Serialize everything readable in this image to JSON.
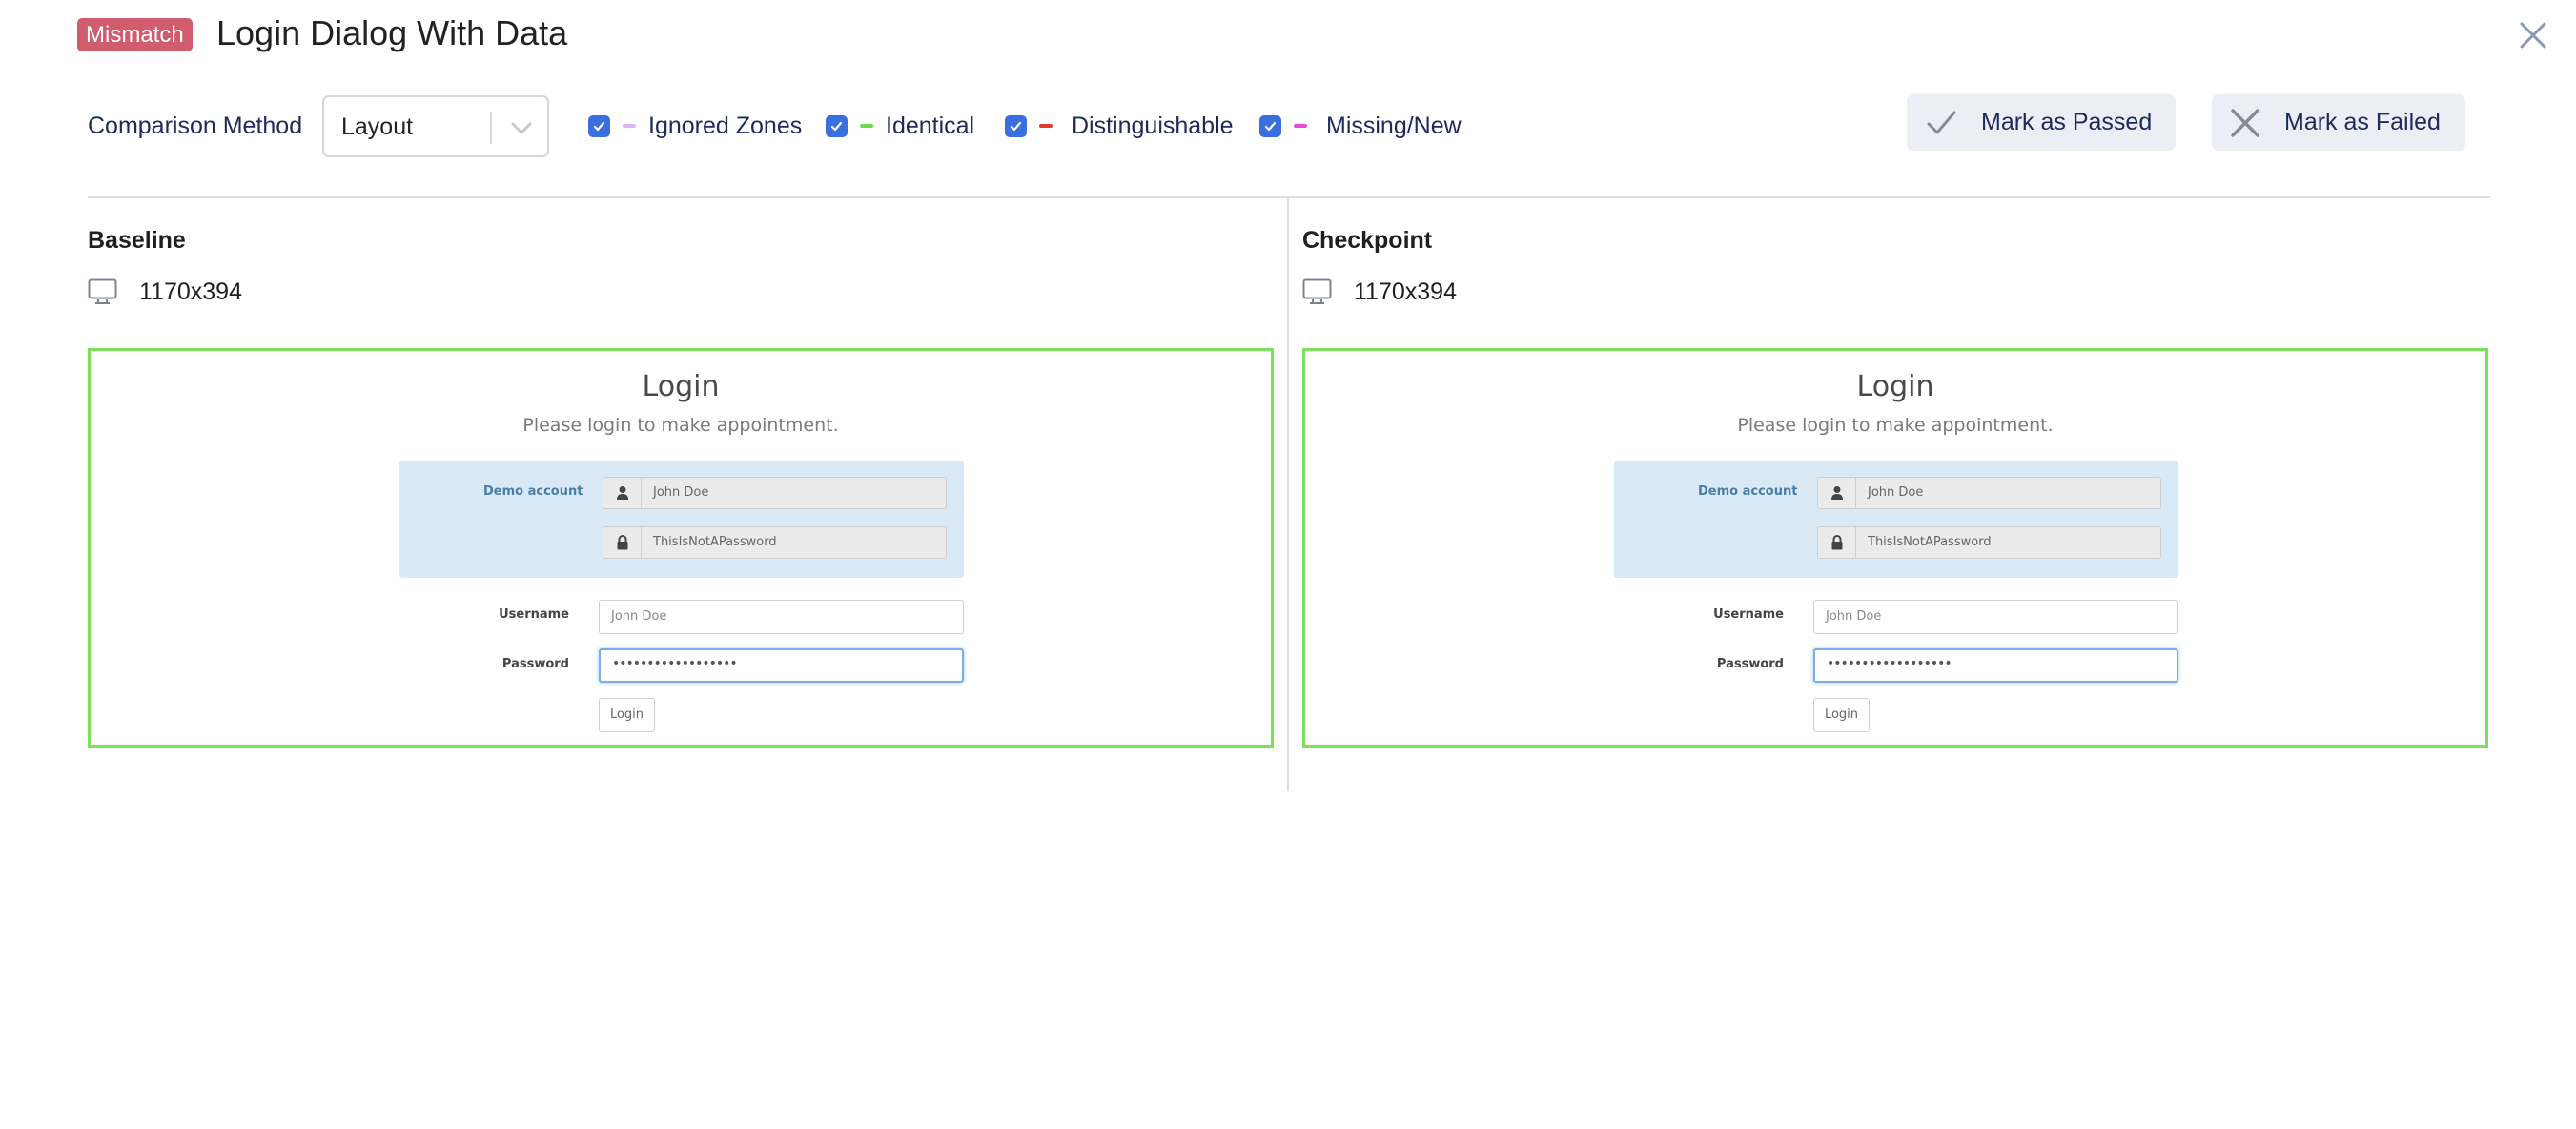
{
  "header": {
    "status_badge": "Mismatch",
    "title": "Login Dialog With Data"
  },
  "toolbar": {
    "comparison_label": "Comparison Method",
    "comparison_value": "Layout",
    "filters": [
      {
        "label": "Ignored Zones",
        "checked": true,
        "color": "#d9b8f0"
      },
      {
        "label": "Identical",
        "checked": true,
        "color": "#6fd84c"
      },
      {
        "label": "Distinguishable",
        "checked": true,
        "color": "#e03a2a"
      },
      {
        "label": "Missing/New",
        "checked": true,
        "color": "#e84bd8"
      }
    ],
    "mark_passed": "Mark as Passed",
    "mark_failed": "Mark as Failed"
  },
  "colors": {
    "badge": "#d05c6d",
    "checkbox": "#3a6fe0",
    "frame_border": "#7de05a",
    "label_text": "#1d2a5a"
  },
  "baseline": {
    "title": "Baseline",
    "dimensions": "1170x394"
  },
  "checkpoint": {
    "title": "Checkpoint",
    "dimensions": "1170x394"
  },
  "screenshot": {
    "heading": "Login",
    "subheading": "Please login to make appointment.",
    "demo_label": "Demo account",
    "demo_username": "John Doe",
    "demo_password": "ThisIsNotAPassword",
    "username_label": "Username",
    "username_value": "John Doe",
    "password_label": "Password",
    "password_value": "••••••••••••••••••",
    "login_button": "Login"
  }
}
